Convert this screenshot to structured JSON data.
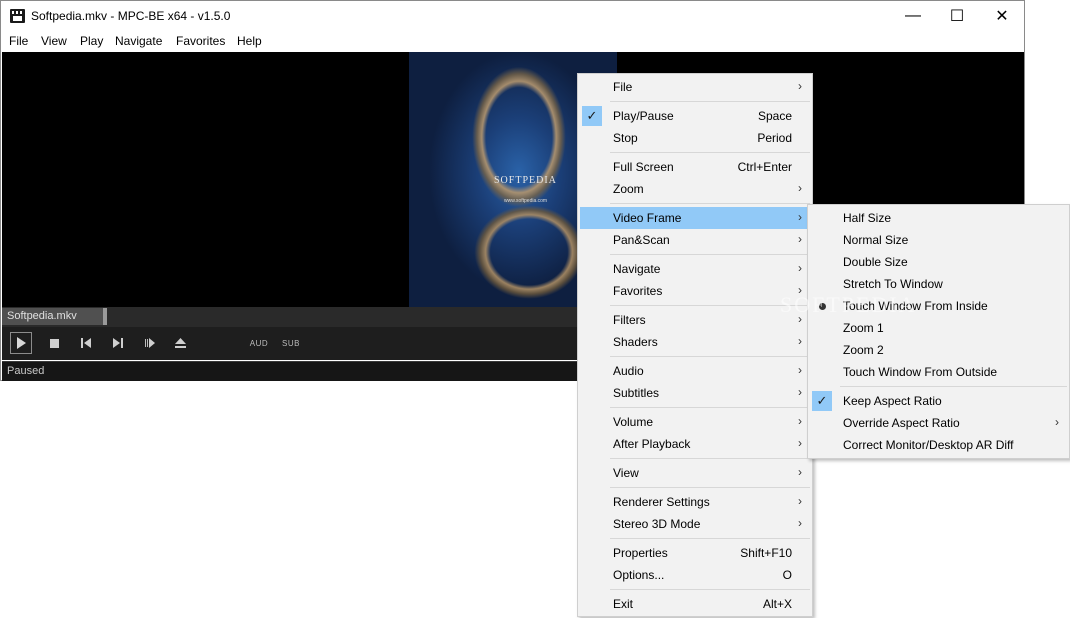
{
  "window": {
    "title": "Softpedia.mkv - MPC-BE x64 - v1.5.0",
    "controls": {
      "minimize": "—",
      "maximize": "☐",
      "close": "✕"
    }
  },
  "menubar": [
    "File",
    "View",
    "Play",
    "Navigate",
    "Favorites",
    "Help"
  ],
  "video": {
    "logo": "SOFTPEDIA",
    "url": "www.softpedia.com"
  },
  "seekbar": {
    "label": "Softpedia.mkv"
  },
  "controls": {
    "aud": "AUD",
    "sub": "SUB"
  },
  "status": {
    "text": "Paused"
  },
  "context_menu": {
    "items": [
      {
        "label": "File",
        "submenu": true
      },
      {
        "label": "Play/Pause",
        "shortcut": "Space",
        "checked": true
      },
      {
        "label": "Stop",
        "shortcut": "Period"
      },
      {
        "label": "Full Screen",
        "shortcut": "Ctrl+Enter"
      },
      {
        "label": "Zoom",
        "submenu": true
      },
      {
        "label": "Video Frame",
        "submenu": true,
        "active": true
      },
      {
        "label": "Pan&Scan",
        "submenu": true
      },
      {
        "label": "Navigate",
        "submenu": true
      },
      {
        "label": "Favorites",
        "submenu": true
      },
      {
        "label": "Filters",
        "submenu": true
      },
      {
        "label": "Shaders",
        "submenu": true
      },
      {
        "label": "Audio",
        "submenu": true
      },
      {
        "label": "Subtitles",
        "submenu": true
      },
      {
        "label": "Volume",
        "submenu": true
      },
      {
        "label": "After Playback",
        "submenu": true
      },
      {
        "label": "View",
        "submenu": true
      },
      {
        "label": "Renderer Settings",
        "submenu": true
      },
      {
        "label": "Stereo 3D Mode",
        "submenu": true
      },
      {
        "label": "Properties",
        "shortcut": "Shift+F10"
      },
      {
        "label": "Options...",
        "shortcut": "O"
      },
      {
        "label": "Exit",
        "shortcut": "Alt+X"
      }
    ]
  },
  "video_frame_submenu": {
    "items": [
      {
        "label": "Half Size"
      },
      {
        "label": "Normal Size"
      },
      {
        "label": "Double Size"
      },
      {
        "label": "Stretch To Window"
      },
      {
        "label": "Touch Window From Inside",
        "selected": true
      },
      {
        "label": "Zoom 1"
      },
      {
        "label": "Zoom 2"
      },
      {
        "label": "Touch Window From Outside"
      },
      {
        "label": "Keep Aspect Ratio",
        "checked": true
      },
      {
        "label": "Override Aspect Ratio",
        "submenu": true
      },
      {
        "label": "Correct Monitor/Desktop AR Diff"
      }
    ]
  },
  "watermark": "SOFTPEDIA"
}
